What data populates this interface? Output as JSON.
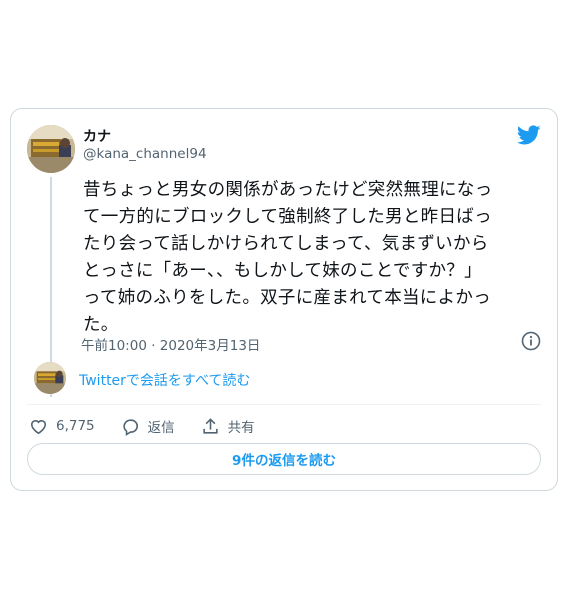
{
  "user": {
    "display_name": "カナ",
    "handle": "@kana_channel94",
    "avatar_icon": "profile-photo-icon"
  },
  "tweet": {
    "text": "昔ちょっと男女の関係があったけど突然無理になっ\nて一方的にブロックして強制終了した男と昨日ばっ\nたり会って話しかけられてしまって、気まずいから\nとっさに「あー、、もしかして妹のことですか？」\nって姉のふりをした。双子に産まれて本当によかっ\nた。",
    "timestamp": "午前10:00 · 2020年3月13日"
  },
  "conversation_link": "Twitterで会話をすべて読む",
  "actions": {
    "like_count": "6,775",
    "reply_label": "返信",
    "share_label": "共有"
  },
  "read_replies_label": "9件の返信を読む",
  "colors": {
    "accent": "#1d9bf0",
    "text": "#0f1419",
    "muted": "#536471",
    "border": "#cfd9de"
  },
  "icons": [
    "twitter-bird-icon",
    "info-icon",
    "heart-icon",
    "reply-bubble-icon",
    "share-icon"
  ]
}
